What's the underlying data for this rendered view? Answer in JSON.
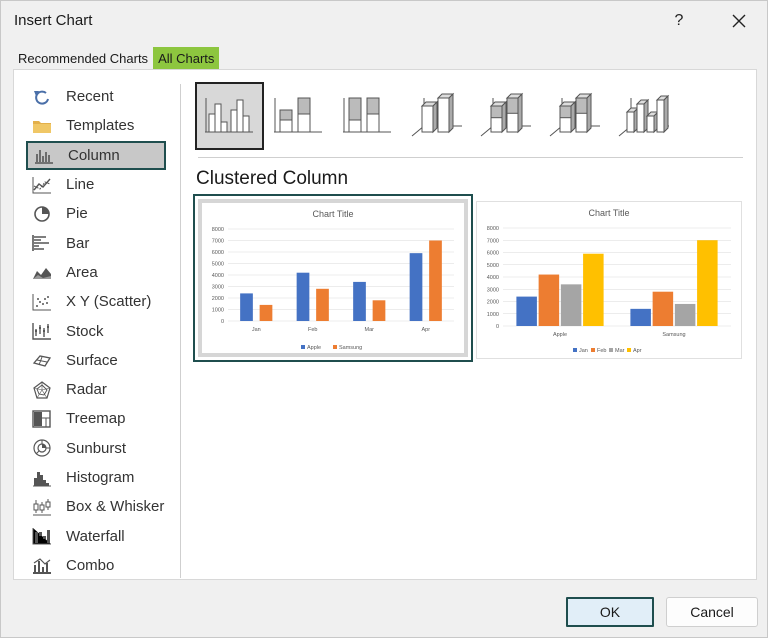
{
  "dialog": {
    "title": "Insert Chart",
    "help": "?",
    "close": "✕"
  },
  "tabs": [
    {
      "label": "Recommended Charts",
      "active": false
    },
    {
      "label": "All Charts",
      "active": true
    }
  ],
  "sidebar": {
    "items": [
      {
        "label": "Recent",
        "icon": "recent-icon"
      },
      {
        "label": "Templates",
        "icon": "templates-folder-icon"
      },
      {
        "label": "Column",
        "icon": "column-chart-icon",
        "selected": true
      },
      {
        "label": "Line",
        "icon": "line-chart-icon"
      },
      {
        "label": "Pie",
        "icon": "pie-chart-icon"
      },
      {
        "label": "Bar",
        "icon": "bar-chart-icon"
      },
      {
        "label": "Area",
        "icon": "area-chart-icon"
      },
      {
        "label": "X Y (Scatter)",
        "icon": "scatter-chart-icon"
      },
      {
        "label": "Stock",
        "icon": "stock-chart-icon"
      },
      {
        "label": "Surface",
        "icon": "surface-chart-icon"
      },
      {
        "label": "Radar",
        "icon": "radar-chart-icon"
      },
      {
        "label": "Treemap",
        "icon": "treemap-chart-icon"
      },
      {
        "label": "Sunburst",
        "icon": "sunburst-chart-icon"
      },
      {
        "label": "Histogram",
        "icon": "histogram-chart-icon"
      },
      {
        "label": "Box & Whisker",
        "icon": "box-whisker-chart-icon"
      },
      {
        "label": "Waterfall",
        "icon": "waterfall-chart-icon"
      },
      {
        "label": "Combo",
        "icon": "combo-chart-icon"
      }
    ]
  },
  "subtypes": [
    {
      "icon": "clustered-column-icon",
      "selected": true
    },
    {
      "icon": "stacked-column-icon"
    },
    {
      "icon": "100-stacked-column-icon"
    },
    {
      "icon": "3d-clustered-column-icon"
    },
    {
      "icon": "3d-stacked-column-icon"
    },
    {
      "icon": "3d-100-stacked-column-icon"
    },
    {
      "icon": "3d-column-icon"
    }
  ],
  "heading": "Clustered Column",
  "colors": {
    "blue": "#4472c4",
    "orange": "#ed7d31",
    "gray": "#a5a5a5",
    "yellow": "#ffc000",
    "grid": "#d9d9d9",
    "axis_text": "#595959",
    "accent": "#1f4e4e",
    "tab_active": "#8dc63f"
  },
  "chart_data": [
    {
      "type": "bar",
      "title": "Chart Title",
      "categories": [
        "Jan",
        "Feb",
        "Mar",
        "Apr"
      ],
      "series": [
        {
          "name": "Apple",
          "values": [
            2400,
            4200,
            3400,
            5900
          ]
        },
        {
          "name": "Samsung",
          "values": [
            1400,
            2800,
            1800,
            7000
          ]
        }
      ],
      "ylim": [
        0,
        8000
      ],
      "yticks": [
        "0",
        "1000",
        "2000",
        "3000",
        "4000",
        "5000",
        "6000",
        "7000",
        "8000"
      ],
      "grid": true,
      "legend": "bottom"
    },
    {
      "type": "bar",
      "title": "Chart Title",
      "categories": [
        "Apple",
        "Samsung"
      ],
      "series": [
        {
          "name": "Jan",
          "values": [
            2400,
            1400
          ]
        },
        {
          "name": "Feb",
          "values": [
            4200,
            2800
          ]
        },
        {
          "name": "Mar",
          "values": [
            3400,
            1800
          ]
        },
        {
          "name": "Apr",
          "values": [
            5900,
            7000
          ]
        }
      ],
      "ylim": [
        0,
        8000
      ],
      "yticks": [
        "0",
        "1000",
        "2000",
        "3000",
        "4000",
        "5000",
        "6000",
        "7000",
        "8000"
      ],
      "grid": true,
      "legend": "bottom"
    }
  ],
  "footer": {
    "ok": "OK",
    "cancel": "Cancel"
  }
}
